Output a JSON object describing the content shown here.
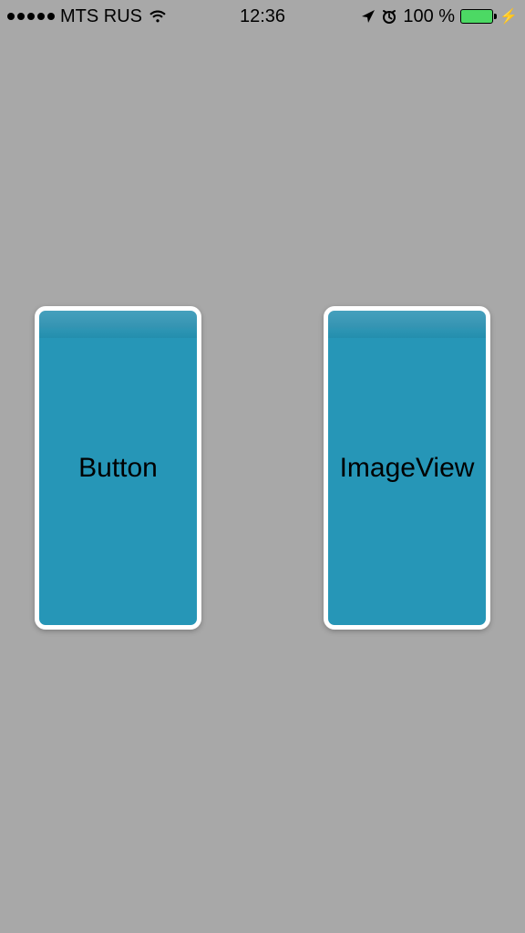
{
  "statusbar": {
    "carrier": "MTS RUS",
    "time": "12:36",
    "battery_text": "100 %"
  },
  "tiles": {
    "left_label": "Button",
    "right_label": "ImageView"
  }
}
